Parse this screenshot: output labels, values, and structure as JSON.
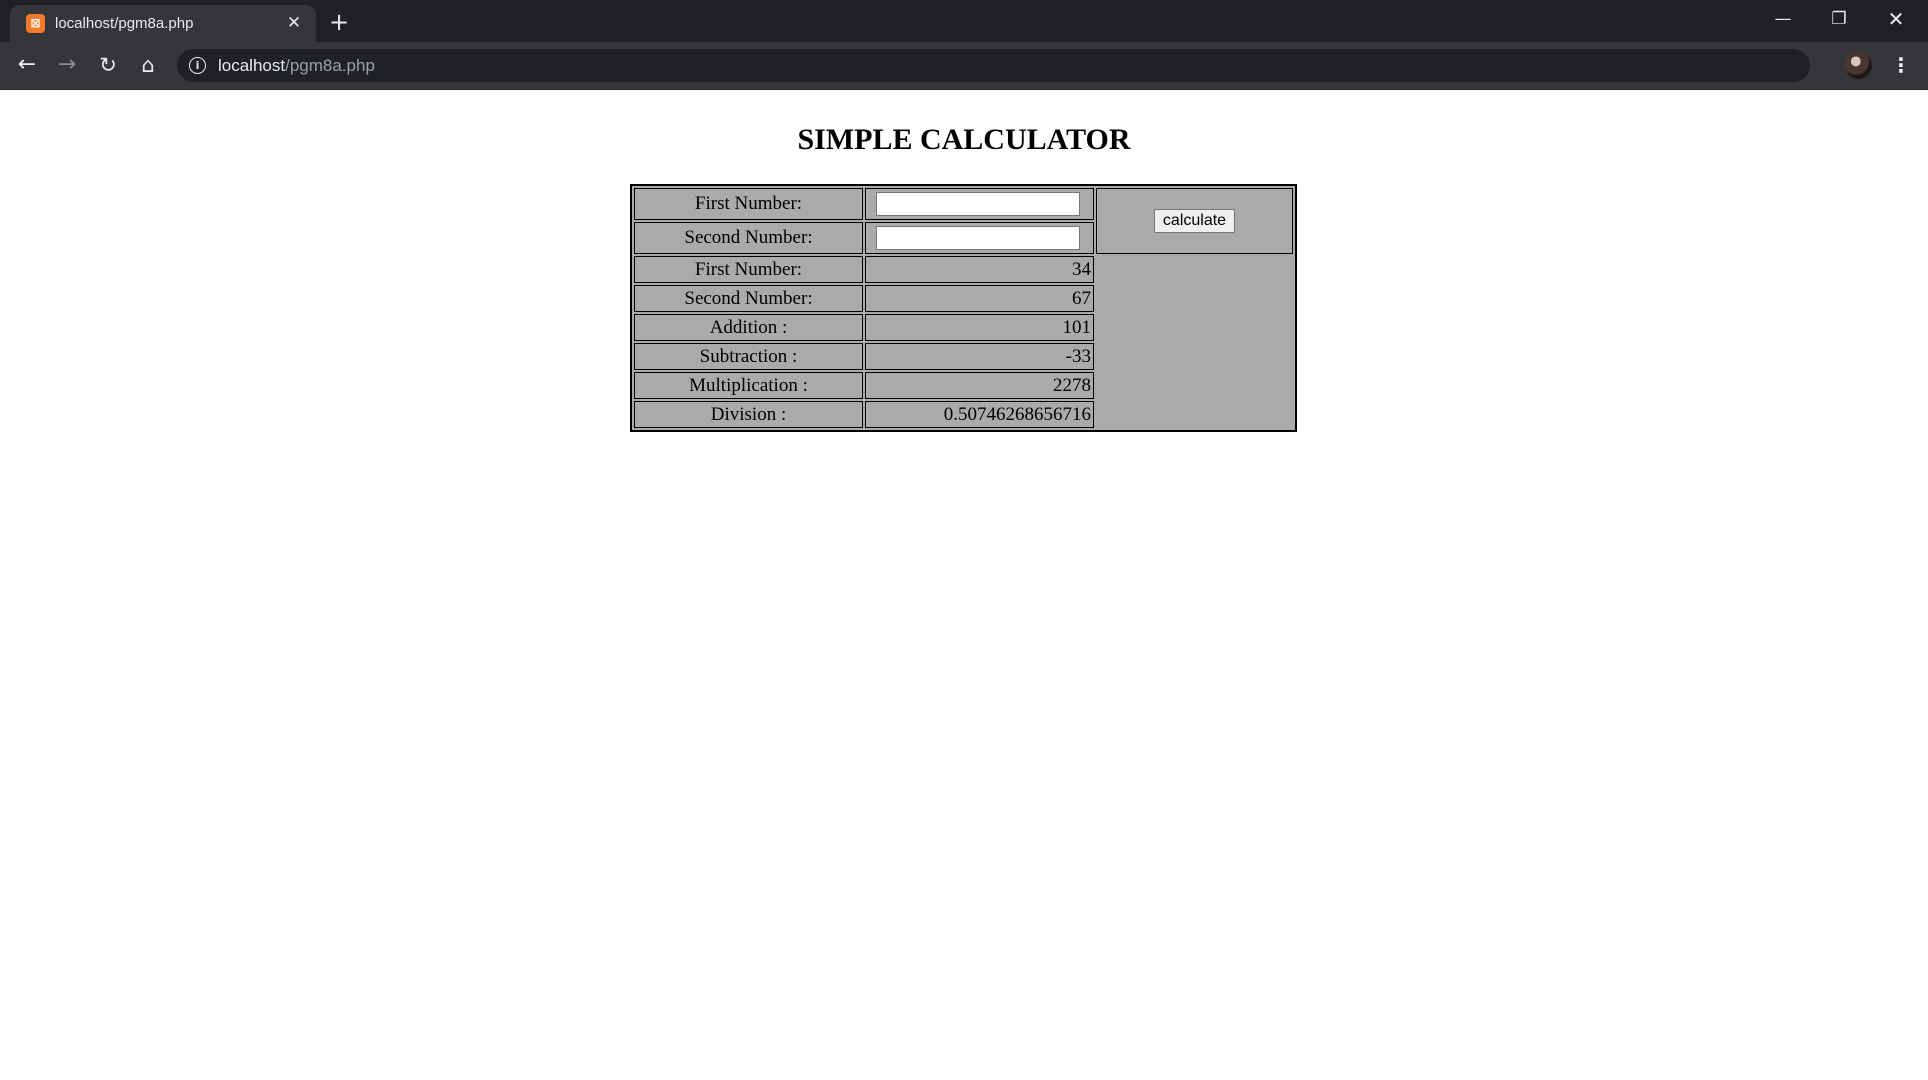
{
  "browser": {
    "tab_title": "localhost/pgm8a.php",
    "favicon": "xampp-icon",
    "url_host": "localhost",
    "url_path": "/pgm8a.php"
  },
  "page": {
    "heading": "SIMPLE CALCULATOR",
    "inputs": [
      {
        "label": "First Number:",
        "value": "",
        "placeholder": ""
      },
      {
        "label": "Second Number:",
        "value": "",
        "placeholder": ""
      }
    ],
    "button_label": "calculate",
    "results": [
      {
        "label": "First Number:",
        "value": "34"
      },
      {
        "label": "Second Number:",
        "value": "67"
      },
      {
        "label": "Addition :",
        "value": "101"
      },
      {
        "label": "Subtraction :",
        "value": "-33"
      },
      {
        "label": "Multiplication :",
        "value": "2278"
      },
      {
        "label": "Division :",
        "value": "0.50746268656716"
      }
    ]
  },
  "colors": {
    "table_bg": "#aaaaaa",
    "chrome_dark": "#202124",
    "chrome_toolbar": "#35363a"
  }
}
